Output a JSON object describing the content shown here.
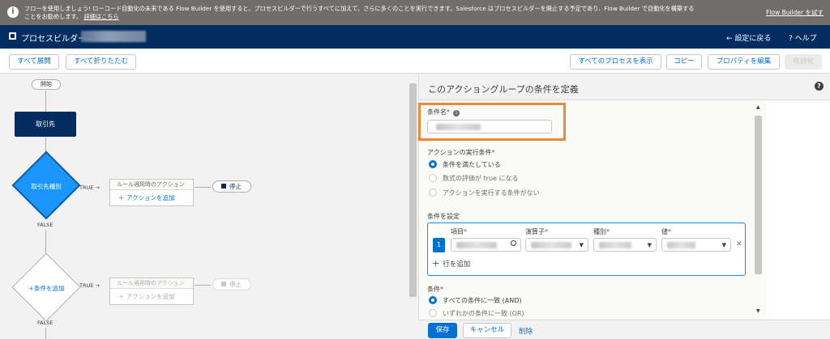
{
  "notice": {
    "message": "フローを使用しましょう! ローコード自動化の未来である Flow Builder を使用すると、プロセスビルダーで行うすべてに加えて、さらに多くのことを実行できます。Salesforce はプロセスビルダーを廃止する予定であり、Flow Builder で自動化を構築することをお勧めします。",
    "details_link": "詳細はこちら",
    "try_link": "Flow Builder を試す"
  },
  "header": {
    "title": "プロセスビルダー -",
    "back_label": "← 設定に戻る",
    "help_label": "? ヘルプ"
  },
  "toolbar": {
    "expand_all": "すべて展開",
    "collapse_all": "すべて折りたたむ",
    "show_all_processes": "すべてのプロセスを表示",
    "copy": "コピー",
    "edit_properties": "プロパティを編集",
    "activate": "有効化"
  },
  "canvas": {
    "start_label": "開始",
    "object_node_label": "取引先",
    "criteria1": {
      "label": "取引先種別",
      "true_label": "TRUE →",
      "false_label": "FALSE",
      "action_header": "ルール適用時のアクション",
      "add_action": "アクションを追加",
      "stop_label": "停止"
    },
    "criteria2": {
      "label": "条件を追加",
      "true_label": "TRUE →",
      "false_label": "FALSE",
      "action_header": "ルール適用時のアクション",
      "add_action": "アクションを追加",
      "stop_label": "停止"
    }
  },
  "panel": {
    "title": "このアクショングループの条件を定義",
    "help_icon": "?",
    "criteria_name_label": "条件名",
    "exec_condition_label": "アクションの実行条件",
    "exec_options": [
      {
        "label": "条件を満たしている",
        "selected": true
      },
      {
        "label": "数式の評価が true になる",
        "selected": false
      },
      {
        "label": "アクションを実行する条件がない",
        "selected": false
      }
    ],
    "set_conditions_label": "条件を設定",
    "columns": {
      "field": "項目",
      "operator": "演算子",
      "type": "種別",
      "value": "値"
    },
    "row_number": "1",
    "add_row": "行を追加",
    "conditions_label": "条件",
    "condition_options": [
      {
        "label": "すべての条件に一致 (AND)",
        "selected": true
      },
      {
        "label": "いずれかの条件に一致 (OR)",
        "selected": false
      }
    ],
    "save": "保存",
    "cancel": "キャンセル",
    "delete": "削除"
  },
  "colors": {
    "header_bg": "#032d60",
    "notice_bg": "#706e6b",
    "brand": "#0070d2",
    "criteria_active": "#1b96ff",
    "highlight_box": "#e9893b"
  },
  "icons": [
    "info-icon",
    "app-icon",
    "help-icon",
    "search-icon",
    "caret-down-icon",
    "close-icon",
    "plus-icon",
    "stop-icon"
  ]
}
